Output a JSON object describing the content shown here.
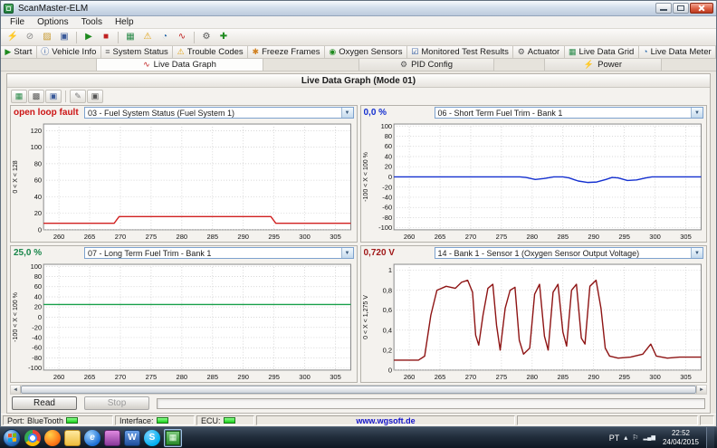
{
  "window": {
    "title": "ScanMaster-ELM"
  },
  "menu": {
    "items": [
      "File",
      "Options",
      "Tools",
      "Help"
    ]
  },
  "tabs1": [
    "Start",
    "Vehicle Info",
    "System Status",
    "Trouble Codes",
    "Freeze Frames",
    "Oxygen Sensors",
    "Monitored Test Results",
    "Actuator",
    "Live Data Grid",
    "Live Data Meter"
  ],
  "tabs2": [
    "Live Data Graph",
    "PID Config",
    "Power"
  ],
  "panel": {
    "title": "Live Data Graph (Mode 01)"
  },
  "icons": {
    "play": "▶",
    "stop_square": "■",
    "info": "ⓘ",
    "list": "≡",
    "warning": "⚠",
    "freeze": "✱",
    "o2": "◉",
    "check": "☑",
    "gear": "⚙",
    "grid": "▦",
    "grid2": "▩",
    "meter": "◔",
    "wave": "∿",
    "bolt": "⚡",
    "folder": "▨",
    "disk": "▣",
    "pencil": "✎",
    "slash": "⊘",
    "plus": "✚",
    "dropdown": "▼",
    "left": "◄",
    "right": "►",
    "tray_arrow": "▴",
    "flag": "⚐",
    "network": "▂▄▆",
    "ie": "e",
    "word": "W",
    "skype": "S",
    "chip": "▦"
  },
  "chart_data": [
    {
      "type": "line",
      "value_label": "open loop fault",
      "value_color": "#cc1414",
      "combo_label": "03 - Fuel System Status (Fuel System 1)",
      "axis_label": "0 < X < 128",
      "line_color": "#d02020",
      "xlim": [
        257.5,
        307.5
      ],
      "ylim": [
        0,
        128
      ],
      "xticks": [
        260,
        265,
        270,
        275,
        280,
        285,
        290,
        295,
        300,
        305
      ],
      "ytick_values": [
        0,
        20,
        40,
        60,
        80,
        100,
        120
      ],
      "ytick_labels": [
        "0",
        "20",
        "40",
        "60",
        "80",
        "100",
        "120"
      ],
      "points": [
        [
          257.5,
          8
        ],
        [
          269,
          8
        ],
        [
          269.8,
          16
        ],
        [
          294.5,
          16
        ],
        [
          295.3,
          8
        ],
        [
          307.5,
          8
        ]
      ]
    },
    {
      "type": "line",
      "value_label": "0,0 %",
      "value_color": "#1430d0",
      "combo_label": "06 - Short Term Fuel Trim - Bank 1",
      "axis_label": "-100 < X < 100 %",
      "line_color": "#1430d0",
      "xlim": [
        257.5,
        307.5
      ],
      "ylim": [
        -104,
        104
      ],
      "xticks": [
        260,
        265,
        270,
        275,
        280,
        285,
        290,
        295,
        300,
        305
      ],
      "ytick_values": [
        -100,
        -80,
        -60,
        -40,
        -20,
        0,
        20,
        40,
        60,
        80,
        100
      ],
      "ytick_labels": [
        "-100",
        "-80",
        "-60",
        "-40",
        "-20",
        "0",
        "20",
        "40",
        "60",
        "80",
        "100"
      ],
      "points": [
        [
          257.5,
          0
        ],
        [
          278,
          0
        ],
        [
          279,
          -1
        ],
        [
          280.5,
          -5
        ],
        [
          282,
          -3
        ],
        [
          283.5,
          0
        ],
        [
          285,
          0
        ],
        [
          286,
          -2
        ],
        [
          287.5,
          -8
        ],
        [
          289,
          -11
        ],
        [
          290.5,
          -10
        ],
        [
          292,
          -5
        ],
        [
          293,
          -1
        ],
        [
          294,
          -2
        ],
        [
          295.5,
          -7
        ],
        [
          297,
          -6
        ],
        [
          298.5,
          -2
        ],
        [
          299.5,
          0
        ],
        [
          307.5,
          0
        ]
      ]
    },
    {
      "type": "line",
      "value_label": "25,0 %",
      "value_color": "#18864a",
      "combo_label": "07 - Long Term Fuel Trim - Bank 1",
      "axis_label": "-100 < X < 100 %",
      "line_color": "#18a04a",
      "xlim": [
        257.5,
        307.5
      ],
      "ylim": [
        -104,
        104
      ],
      "xticks": [
        260,
        265,
        270,
        275,
        280,
        285,
        290,
        295,
        300,
        305
      ],
      "ytick_values": [
        -100,
        -80,
        -60,
        -40,
        -20,
        0,
        20,
        40,
        60,
        80,
        100
      ],
      "ytick_labels": [
        "-100",
        "-80",
        "-60",
        "-40",
        "-20",
        "0",
        "20",
        "40",
        "60",
        "80",
        "100"
      ],
      "points": [
        [
          257.5,
          25
        ],
        [
          307.5,
          25
        ]
      ]
    },
    {
      "type": "line",
      "value_label": "0,720 V",
      "value_color": "#a01818",
      "combo_label": "14 - Bank 1 - Sensor 1 (Oxygen Sensor Output Voltage)",
      "axis_label": "0 < X < 1,275 V",
      "line_color": "#8e1414",
      "xlim": [
        257.5,
        307.5
      ],
      "ylim": [
        0,
        1.06
      ],
      "xticks": [
        260,
        265,
        270,
        275,
        280,
        285,
        290,
        295,
        300,
        305
      ],
      "ytick_values": [
        0,
        0.2,
        0.4,
        0.6,
        0.8,
        1
      ],
      "ytick_labels": [
        "0",
        "0,2",
        "0,4",
        "0,6",
        "0,8",
        "1"
      ],
      "points": [
        [
          257.5,
          0.1
        ],
        [
          261.5,
          0.1
        ],
        [
          262.5,
          0.14
        ],
        [
          263.5,
          0.55
        ],
        [
          264.5,
          0.8
        ],
        [
          266,
          0.84
        ],
        [
          267.5,
          0.82
        ],
        [
          268.5,
          0.88
        ],
        [
          269.5,
          0.9
        ],
        [
          270.3,
          0.78
        ],
        [
          270.8,
          0.35
        ],
        [
          271.3,
          0.25
        ],
        [
          272,
          0.55
        ],
        [
          272.8,
          0.82
        ],
        [
          273.6,
          0.86
        ],
        [
          274.2,
          0.45
        ],
        [
          274.8,
          0.2
        ],
        [
          275.6,
          0.62
        ],
        [
          276.4,
          0.8
        ],
        [
          277.2,
          0.83
        ],
        [
          277.9,
          0.3
        ],
        [
          278.6,
          0.16
        ],
        [
          279.6,
          0.22
        ],
        [
          280.4,
          0.76
        ],
        [
          281.2,
          0.86
        ],
        [
          282,
          0.34
        ],
        [
          282.6,
          0.2
        ],
        [
          283.4,
          0.78
        ],
        [
          284.2,
          0.86
        ],
        [
          285,
          0.38
        ],
        [
          285.6,
          0.24
        ],
        [
          286.4,
          0.8
        ],
        [
          287.2,
          0.86
        ],
        [
          288,
          0.32
        ],
        [
          288.6,
          0.26
        ],
        [
          289.4,
          0.84
        ],
        [
          290.4,
          0.9
        ],
        [
          291.2,
          0.62
        ],
        [
          291.9,
          0.22
        ],
        [
          292.6,
          0.14
        ],
        [
          294,
          0.12
        ],
        [
          296,
          0.13
        ],
        [
          298,
          0.16
        ],
        [
          299.3,
          0.26
        ],
        [
          300.2,
          0.14
        ],
        [
          302,
          0.12
        ],
        [
          304,
          0.13
        ],
        [
          307.5,
          0.13
        ]
      ]
    }
  ],
  "controls": {
    "read": "Read",
    "stop": "Stop"
  },
  "statusbar": {
    "port_label": "Port:",
    "port_value": "BlueTooth",
    "interface_label": "Interface:",
    "ecu_label": "ECU:",
    "website": "www.wgsoft.de"
  },
  "taskbar": {
    "language": "PT",
    "time": "22:52",
    "date": "24/04/2015"
  }
}
